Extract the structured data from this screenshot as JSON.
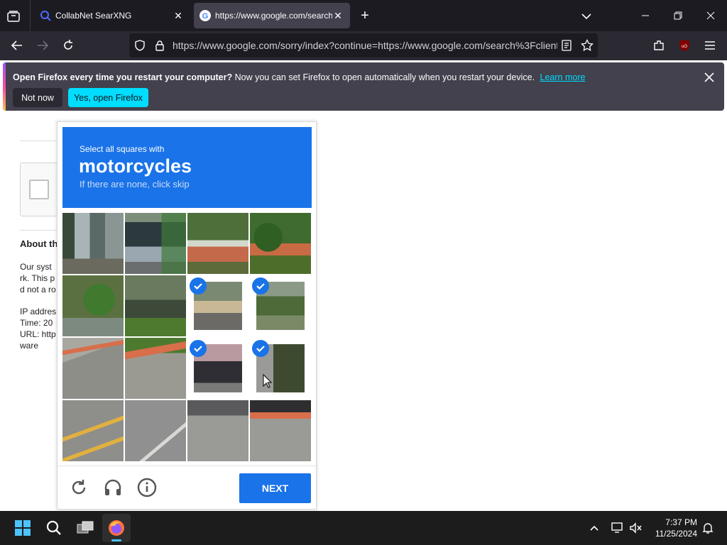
{
  "browser": {
    "tabs": [
      {
        "title": "CollabNet SearXNG",
        "active": false
      },
      {
        "title": "https://www.google.com/search?q",
        "active": true
      }
    ],
    "url": "https://www.google.com/sorry/index?continue=https://www.google.com/search%3Fclient"
  },
  "notification": {
    "bold_text": "Open Firefox every time you restart your computer?",
    "text": "Now you can set Firefox to open automatically when you restart your device.",
    "link": "Learn more",
    "not_now": "Not now",
    "yes_open": "Yes, open Firefox"
  },
  "page": {
    "about_heading": "About th",
    "lines": [
      "Our syst",
      "rk. This p",
      "d not a ro",
      "",
      "IP addres",
      "Time: 20",
      "URL: http",
      "ware"
    ]
  },
  "captcha": {
    "prefix": "Select all squares with",
    "target": "motorcycles",
    "hint": "If there are none, click skip",
    "next_label": "NEXT",
    "selected_tiles": [
      6,
      7,
      10,
      11
    ]
  },
  "taskbar": {
    "time": "7:37 PM",
    "date": "11/25/2024"
  },
  "colors": {
    "accent": "#1a73e8",
    "firefox_link": "#00ddff"
  }
}
